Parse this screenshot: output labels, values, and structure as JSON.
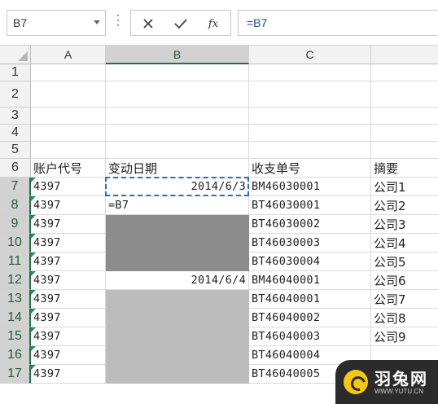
{
  "formula_bar": {
    "name_box": "B7",
    "formula": "=B7",
    "buttons": {
      "cancel": "✕",
      "enter": "✓",
      "fx": "fx"
    }
  },
  "columns": [
    "A",
    "B",
    "C",
    ""
  ],
  "selected_column": "B",
  "rows": [
    {
      "num": "1",
      "a": "",
      "b": "",
      "c": "",
      "d": ""
    },
    {
      "num": "2",
      "a": "",
      "b": "",
      "c": "",
      "d": ""
    },
    {
      "num": "3",
      "a": "",
      "b": "",
      "c": "",
      "d": ""
    },
    {
      "num": "4",
      "a": "",
      "b": "",
      "c": "",
      "d": ""
    },
    {
      "num": "5",
      "a": "",
      "b": "",
      "c": "",
      "d": ""
    },
    {
      "num": "6",
      "a": "账户代号",
      "b": "变动日期",
      "c": "收支单号",
      "d": "摘要"
    },
    {
      "num": "7",
      "a": "4397",
      "b": "2014/6/3",
      "c": "BM46030001",
      "d": "公司1"
    },
    {
      "num": "8",
      "a": "4397",
      "b": "=B7",
      "c": "BT46030001",
      "d": "公司2"
    },
    {
      "num": "9",
      "a": "4397",
      "b": "",
      "c": "BT46030002",
      "d": "公司3"
    },
    {
      "num": "10",
      "a": "4397",
      "b": "",
      "c": "BT46030003",
      "d": "公司4"
    },
    {
      "num": "11",
      "a": "4397",
      "b": "",
      "c": "BT46030004",
      "d": "公司5"
    },
    {
      "num": "12",
      "a": "4397",
      "b": "2014/6/4",
      "c": "BM46040001",
      "d": "公司6"
    },
    {
      "num": "13",
      "a": "4397",
      "b": "",
      "c": "BT46040001",
      "d": "公司7"
    },
    {
      "num": "14",
      "a": "4397",
      "b": "",
      "c": "BT46040002",
      "d": "公司8"
    },
    {
      "num": "15",
      "a": "4397",
      "b": "",
      "c": "BT46040003",
      "d": "公司9"
    },
    {
      "num": "16",
      "a": "4397",
      "b": "",
      "c": "BT46040004",
      "d": ""
    },
    {
      "num": "17",
      "a": "4397",
      "b": "",
      "c": "BT46040005",
      "d": ""
    }
  ],
  "watermark": {
    "title": "羽兔网",
    "url": "WWW.YUTU.CN"
  },
  "colors": {
    "accent": "#217346",
    "dashed_border": "#2e6fb0",
    "fill_dark": "#8c8c8c",
    "fill_light": "#bcbcbc",
    "error_flag": "#2e8b57"
  }
}
